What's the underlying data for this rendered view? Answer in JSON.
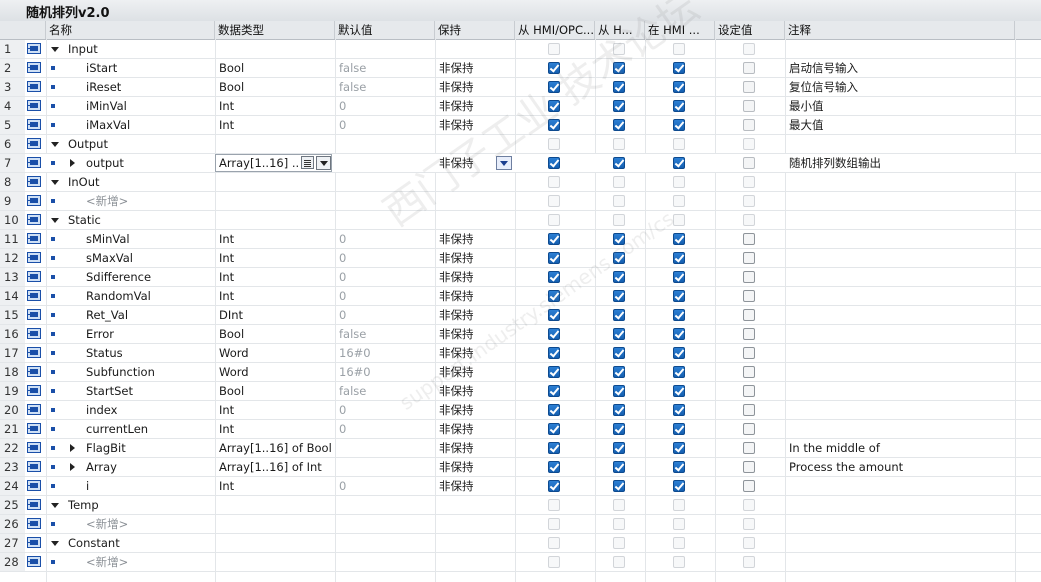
{
  "window": {
    "title": "随机排列v2.0"
  },
  "columns": {
    "name": "名称",
    "datatype": "数据类型",
    "default": "默认值",
    "retain": "保持",
    "hmi_opc": "从 HMI/OPC...",
    "hmi_h": "从 H...",
    "in_hmi": "在 HMI ...",
    "setpoint": "设定值",
    "comment": "注释"
  },
  "rows": [
    {
      "num": "1",
      "kind": "section",
      "name": "Input",
      "expand": "down",
      "hmi1": false,
      "hmi2": false,
      "hmi3": false,
      "sp": false,
      "dim": true
    },
    {
      "num": "2",
      "kind": "var",
      "name": "iStart",
      "type": "Bool",
      "def": "false",
      "retain": "非保持",
      "hmi1": true,
      "hmi2": true,
      "hmi3": true,
      "sp": false,
      "comment": "启动信号输入"
    },
    {
      "num": "3",
      "kind": "var",
      "name": "iReset",
      "type": "Bool",
      "def": "false",
      "retain": "非保持",
      "hmi1": true,
      "hmi2": true,
      "hmi3": true,
      "sp": false,
      "comment": "复位信号输入"
    },
    {
      "num": "4",
      "kind": "var",
      "name": "iMinVal",
      "type": "Int",
      "def": "0",
      "retain": "非保持",
      "hmi1": true,
      "hmi2": true,
      "hmi3": true,
      "sp": false,
      "comment": "最小值"
    },
    {
      "num": "5",
      "kind": "var",
      "name": "iMaxVal",
      "type": "Int",
      "def": "0",
      "retain": "非保持",
      "hmi1": true,
      "hmi2": true,
      "hmi3": true,
      "sp": false,
      "comment": "最大值"
    },
    {
      "num": "6",
      "kind": "section",
      "name": "Output",
      "expand": "down",
      "hmi1": false,
      "hmi2": false,
      "hmi3": false,
      "sp": false,
      "dim": true
    },
    {
      "num": "7",
      "kind": "var",
      "name": "output",
      "expand": "right",
      "type": "Array[1..16] ...",
      "def": "",
      "retain": "非保持",
      "hmi1": true,
      "hmi2": true,
      "hmi3": true,
      "sp": false,
      "comment": "随机排列数组输出",
      "selected": true
    },
    {
      "num": "8",
      "kind": "section",
      "name": "InOut",
      "expand": "down",
      "hmi1": false,
      "hmi2": false,
      "hmi3": false,
      "sp": false,
      "dim": true
    },
    {
      "num": "9",
      "kind": "add",
      "name": "<新增>",
      "hmi1": false,
      "hmi2": false,
      "hmi3": false,
      "sp": false,
      "dim": true
    },
    {
      "num": "10",
      "kind": "section",
      "name": "Static",
      "expand": "down",
      "hmi1": false,
      "hmi2": false,
      "hmi3": false,
      "sp": false,
      "dim": true
    },
    {
      "num": "11",
      "kind": "var",
      "name": "sMinVal",
      "type": "Int",
      "def": "0",
      "retain": "非保持",
      "hmi1": true,
      "hmi2": true,
      "hmi3": true,
      "sp": false,
      "setdark": true
    },
    {
      "num": "12",
      "kind": "var",
      "name": "sMaxVal",
      "type": "Int",
      "def": "0",
      "retain": "非保持",
      "hmi1": true,
      "hmi2": true,
      "hmi3": true,
      "sp": false,
      "setdark": true
    },
    {
      "num": "13",
      "kind": "var",
      "name": "Sdifference",
      "type": "Int",
      "def": "0",
      "retain": "非保持",
      "hmi1": true,
      "hmi2": true,
      "hmi3": true,
      "sp": false,
      "setdark": true
    },
    {
      "num": "14",
      "kind": "var",
      "name": "RandomVal",
      "type": "Int",
      "def": "0",
      "retain": "非保持",
      "hmi1": true,
      "hmi2": true,
      "hmi3": true,
      "sp": false,
      "setdark": true
    },
    {
      "num": "15",
      "kind": "var",
      "name": "Ret_Val",
      "type": "DInt",
      "def": "0",
      "retain": "非保持",
      "hmi1": true,
      "hmi2": true,
      "hmi3": true,
      "sp": false,
      "setdark": true
    },
    {
      "num": "16",
      "kind": "var",
      "name": "Error",
      "type": "Bool",
      "def": "false",
      "retain": "非保持",
      "hmi1": true,
      "hmi2": true,
      "hmi3": true,
      "sp": false,
      "setdark": true
    },
    {
      "num": "17",
      "kind": "var",
      "name": "Status",
      "type": "Word",
      "def": "16#0",
      "retain": "非保持",
      "hmi1": true,
      "hmi2": true,
      "hmi3": true,
      "sp": false,
      "setdark": true
    },
    {
      "num": "18",
      "kind": "var",
      "name": "Subfunction",
      "type": "Word",
      "def": "16#0",
      "retain": "非保持",
      "hmi1": true,
      "hmi2": true,
      "hmi3": true,
      "sp": false,
      "setdark": true
    },
    {
      "num": "19",
      "kind": "var",
      "name": "StartSet",
      "type": "Bool",
      "def": "false",
      "retain": "非保持",
      "hmi1": true,
      "hmi2": true,
      "hmi3": true,
      "sp": false,
      "setdark": true
    },
    {
      "num": "20",
      "kind": "var",
      "name": "index",
      "type": "Int",
      "def": "0",
      "retain": "非保持",
      "hmi1": true,
      "hmi2": true,
      "hmi3": true,
      "sp": false,
      "setdark": true
    },
    {
      "num": "21",
      "kind": "var",
      "name": "currentLen",
      "type": "Int",
      "def": "0",
      "retain": "非保持",
      "hmi1": true,
      "hmi2": true,
      "hmi3": true,
      "sp": false,
      "setdark": true
    },
    {
      "num": "22",
      "kind": "var",
      "name": "FlagBit",
      "expand": "right",
      "type": "Array[1..16] of Bool",
      "def": "",
      "retain": "非保持",
      "hmi1": true,
      "hmi2": true,
      "hmi3": true,
      "sp": false,
      "setdark": true,
      "comment": "In the middle of"
    },
    {
      "num": "23",
      "kind": "var",
      "name": "Array",
      "expand": "right",
      "type": "Array[1..16] of Int",
      "def": "",
      "retain": "非保持",
      "hmi1": true,
      "hmi2": true,
      "hmi3": true,
      "sp": false,
      "setdark": true,
      "comment": "Process the amount"
    },
    {
      "num": "24",
      "kind": "var",
      "name": "i",
      "type": "Int",
      "def": "0",
      "retain": "非保持",
      "hmi1": true,
      "hmi2": true,
      "hmi3": true,
      "sp": false,
      "setdark": true
    },
    {
      "num": "25",
      "kind": "section",
      "name": "Temp",
      "expand": "down",
      "hmi1": false,
      "hmi2": false,
      "hmi3": false,
      "sp": false,
      "dim": true
    },
    {
      "num": "26",
      "kind": "add",
      "name": "<新增>",
      "hmi1": false,
      "hmi2": false,
      "hmi3": false,
      "sp": false,
      "dim": true
    },
    {
      "num": "27",
      "kind": "section",
      "name": "Constant",
      "expand": "down",
      "hmi1": false,
      "hmi2": false,
      "hmi3": false,
      "sp": false,
      "dim": true
    },
    {
      "num": "28",
      "kind": "add",
      "name": "<新增>",
      "hmi1": false,
      "hmi2": false,
      "hmi3": false,
      "sp": false,
      "dim": true
    }
  ],
  "icons": {
    "interface": "db-interface-icon",
    "var": "variable-icon"
  },
  "colors": {
    "checkbox_on": "#1b67be",
    "header_bg": "#e6e9ec",
    "interface_icon": "#1a4fa8"
  },
  "watermark": {
    "line1": "西门子工业 技术论坛",
    "line2": "support.industry.siemens.com/cs"
  }
}
